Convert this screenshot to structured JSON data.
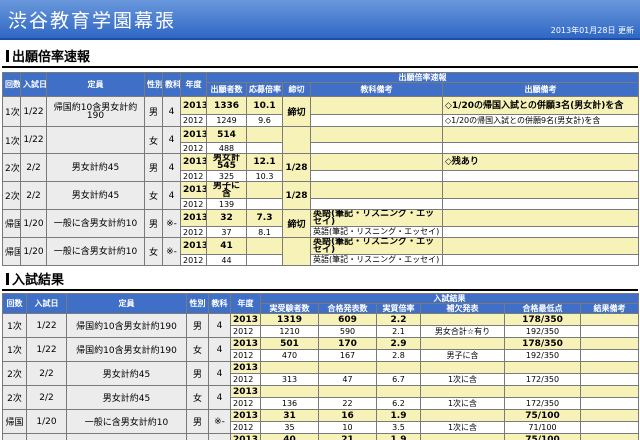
{
  "header": {
    "title": "渋谷教育学園幕張",
    "date": "2013年01月28日 更新"
  },
  "section1": {
    "title": "出願倍率速報",
    "headers": {
      "kai": "回数",
      "nyushi": "入試日",
      "teiin": "定員",
      "sex": "性別",
      "kyouka": "教科",
      "nendo": "年度",
      "group": "出願倍率速報",
      "sha": "出願者数",
      "bairitsu": "応募倍率",
      "shime": "締切",
      "biko_k": "教科備考",
      "biko_s": "出願備考"
    },
    "rows": [
      {
        "kai": "1次",
        "date": "1/22",
        "teiin": "帰国約10含男女計約190",
        "sex": "男",
        "kyouka": "4",
        "y1": "2013",
        "n1": "1336",
        "b1": "10.1",
        "s1": "締切",
        "k1": "",
        "biko1": "◇1/20の帰国入試との併願3名(男女計)を含",
        "y2": "2012",
        "n2": "1249",
        "b2": "9.6",
        "k2": "",
        "biko2": "◇1/20の帰国入試との併願9名(男女計)を含"
      },
      {
        "kai": "1次",
        "date": "1/22",
        "teiin": "",
        "sex": "女",
        "kyouka": "4",
        "y1": "2013",
        "n1": "514",
        "b1": "",
        "s1": "",
        "k1": "",
        "biko1": "",
        "y2": "2012",
        "n2": "488",
        "b2": "",
        "k2": "",
        "biko2": ""
      },
      {
        "kai": "2次",
        "date": "2/2",
        "teiin": "男女計約45",
        "sex": "男",
        "kyouka": "4",
        "y1": "2013",
        "n1": "男女計 545",
        "b1": "12.1",
        "s1": "1/28",
        "k1": "",
        "biko1": "◇残あり",
        "y2": "2012",
        "n2": "325",
        "b2": "10.3",
        "k2": "",
        "biko2": ""
      },
      {
        "kai": "2次",
        "date": "2/2",
        "teiin": "男女計約45",
        "sex": "女",
        "kyouka": "4",
        "y1": "2013",
        "n1": "男子に含",
        "b1": "",
        "s1": "1/28",
        "k1": "",
        "biko1": "",
        "y2": "2012",
        "n2": "139",
        "b2": "",
        "k2": "",
        "biko2": ""
      },
      {
        "kai": "帰国",
        "date": "1/20",
        "teiin": "一般に含男女計約10",
        "sex": "男",
        "kyouka": "※-",
        "y1": "2013",
        "n1": "32",
        "b1": "7.3",
        "s1": "締切",
        "k1": "英語(筆記・リスニング・エッセイ)",
        "biko1": "",
        "y2": "2012",
        "n2": "37",
        "b2": "8.1",
        "k2": "英語(筆記・リスニング・エッセイ)",
        "biko2": ""
      },
      {
        "kai": "帰国",
        "date": "1/20",
        "teiin": "一般に含男女計約10",
        "sex": "女",
        "kyouka": "※-",
        "y1": "2013",
        "n1": "41",
        "b1": "",
        "s1": "",
        "k1": "英語(筆記・リスニング・エッセイ)",
        "biko1": "",
        "y2": "2012",
        "n2": "44",
        "b2": "",
        "k2": "英語(筆記・リスニング・エッセイ)",
        "biko2": ""
      }
    ]
  },
  "section2": {
    "title": "入試結果",
    "headers": {
      "kai": "回数",
      "nyushi": "入試日",
      "teiin": "定員",
      "sex": "性別",
      "kyouka": "教科",
      "nendo": "年度",
      "group": "入試結果",
      "juken": "実受験者数",
      "gokaku": "合格発表数",
      "jitsu": "実質倍率",
      "hoketsu": "補欠発表",
      "saitei": "合格最低点",
      "biko": "結果備考"
    },
    "rows": [
      {
        "kai": "1次",
        "date": "1/22",
        "teiin": "帰国約10含男女計約190",
        "sex": "男",
        "kyouka": "4",
        "a": [
          "2013",
          "1319",
          "609",
          "2.2",
          "",
          "178/350",
          ""
        ],
        "b": [
          "2012",
          "1210",
          "590",
          "2.1",
          "男女合計☆有り",
          "192/350",
          ""
        ]
      },
      {
        "kai": "1次",
        "date": "1/22",
        "teiin": "帰国約10含男女計約190",
        "sex": "女",
        "kyouka": "4",
        "a": [
          "2013",
          "501",
          "170",
          "2.9",
          "",
          "178/350",
          ""
        ],
        "b": [
          "2012",
          "470",
          "167",
          "2.8",
          "男子に含",
          "192/350",
          ""
        ]
      },
      {
        "kai": "2次",
        "date": "2/2",
        "teiin": "男女計約45",
        "sex": "男",
        "kyouka": "4",
        "a": [
          "2013",
          "",
          "",
          "",
          "",
          "",
          ""
        ],
        "b": [
          "2012",
          "313",
          "47",
          "6.7",
          "1次に含",
          "172/350",
          ""
        ]
      },
      {
        "kai": "2次",
        "date": "2/2",
        "teiin": "男女計約45",
        "sex": "女",
        "kyouka": "4",
        "a": [
          "2013",
          "",
          "",
          "",
          "",
          "",
          ""
        ],
        "b": [
          "2012",
          "136",
          "22",
          "6.2",
          "1次に含",
          "172/350",
          ""
        ]
      },
      {
        "kai": "帰国",
        "date": "1/20",
        "teiin": "一般に含男女計約10",
        "sex": "男",
        "kyouka": "※-",
        "a": [
          "2013",
          "31",
          "16",
          "1.9",
          "",
          "75/100",
          ""
        ],
        "b": [
          "2012",
          "35",
          "10",
          "3.5",
          "1次に含",
          "71/100",
          ""
        ]
      },
      {
        "kai": "帰国",
        "date": "1/20",
        "teiin": "一般に含男女計約10",
        "sex": "女",
        "kyouka": "※-",
        "a": [
          "2013",
          "40",
          "21",
          "1.9",
          "",
          "75/100",
          ""
        ],
        "b": [
          "2012",
          "43",
          "24",
          "1.8",
          "1次に含",
          "71/100",
          ""
        ]
      }
    ]
  }
}
